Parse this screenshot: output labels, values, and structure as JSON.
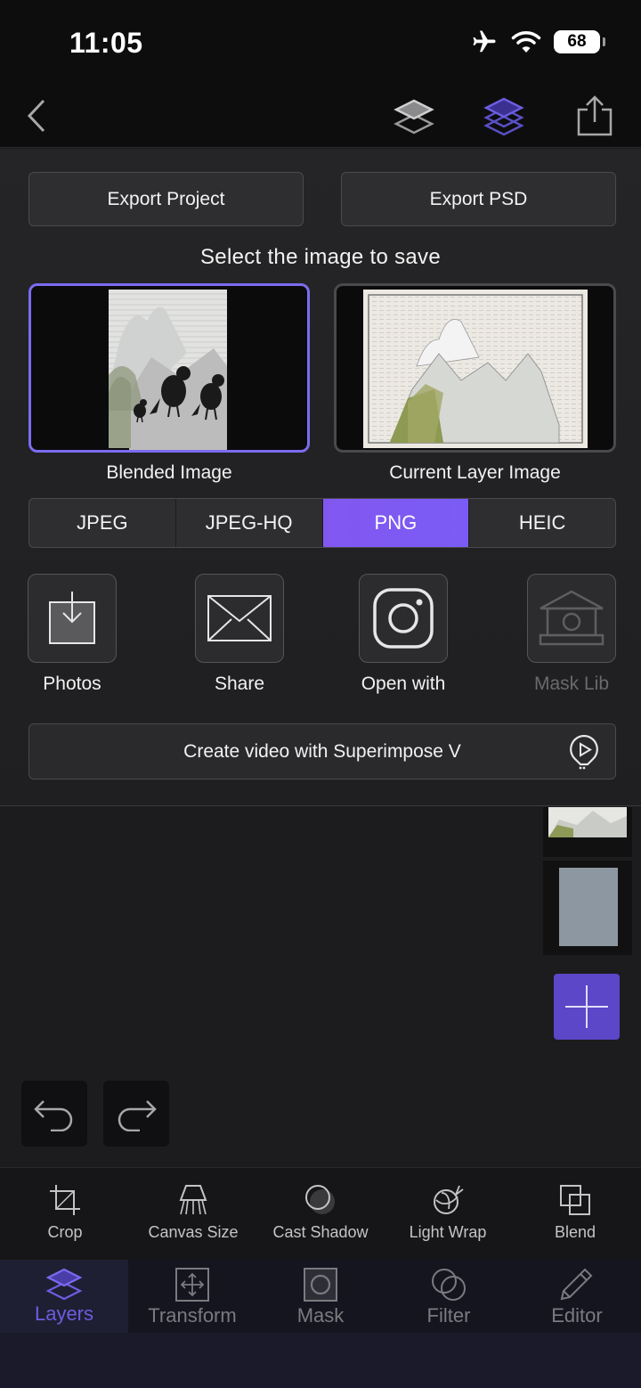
{
  "status": {
    "time": "11:05",
    "battery": "68"
  },
  "icons": {
    "back": "chevron-left-icon",
    "layers_blend": "layers-outline-icon",
    "layers_stack": "layers-stack-icon",
    "share": "share-icon"
  },
  "export": {
    "project_label": "Export Project",
    "psd_label": "Export PSD"
  },
  "select_title": "Select the image to save",
  "images": [
    {
      "caption": "Blended Image",
      "selected": true
    },
    {
      "caption": "Current Layer Image",
      "selected": false
    }
  ],
  "formats": [
    "JPEG",
    "JPEG-HQ",
    "PNG",
    "HEIC"
  ],
  "selected_format": "PNG",
  "share_targets": [
    {
      "label": "Photos",
      "icon": "save-to-photos-icon",
      "enabled": true
    },
    {
      "label": "Share",
      "icon": "envelope-icon",
      "enabled": true
    },
    {
      "label": "Open with",
      "icon": "instagram-icon",
      "enabled": true
    },
    {
      "label": "Mask Lib",
      "icon": "museum-icon",
      "enabled": false
    }
  ],
  "video_button": "Create video with Superimpose V",
  "tools": [
    "Crop",
    "Canvas Size",
    "Cast Shadow",
    "Light Wrap",
    "Blend"
  ],
  "tabs": [
    "Layers",
    "Transform",
    "Mask",
    "Filter",
    "Editor"
  ],
  "active_tab": "Layers",
  "colors": {
    "accent": "#7b6cf0",
    "segment_active": "#8257f0",
    "add_button": "#5b47c7"
  }
}
